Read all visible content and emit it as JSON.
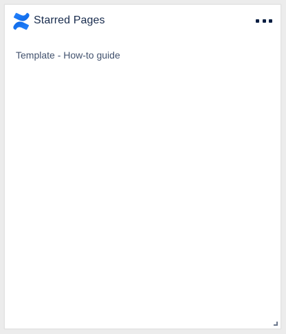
{
  "widget": {
    "title": "Starred Pages",
    "logo_icon": "confluence-logo-icon",
    "more_icon": "more-horizontal-icon",
    "brand_color": "#1868db"
  },
  "starred_pages": [
    {
      "label": "Template - How-to guide"
    }
  ]
}
